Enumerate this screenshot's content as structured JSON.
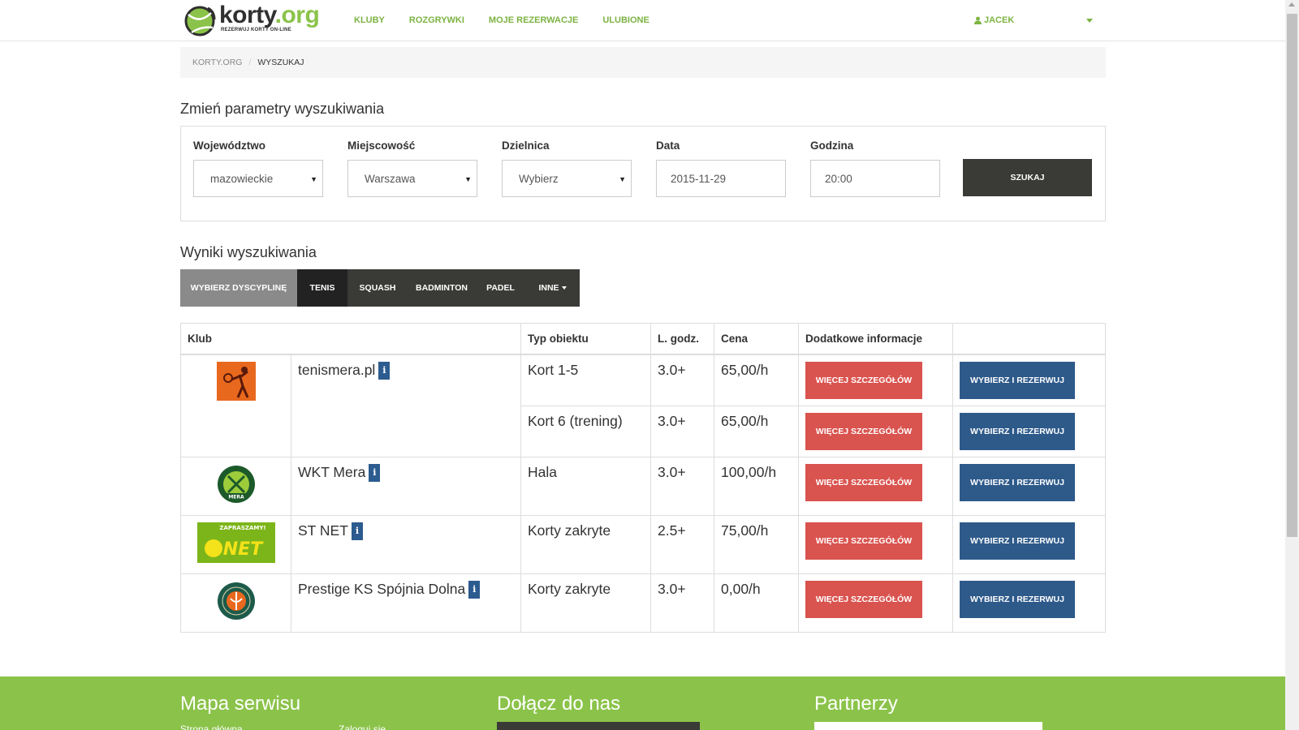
{
  "brand": {
    "name_main": "korty",
    "name_tld": ".org",
    "tagline": "REZERWUJ KORTY ON-LINE",
    "accent_color": "#8bc34a",
    "logo_icon": "tennis-ball-logo-icon"
  },
  "nav": {
    "items": [
      {
        "label": "KLUBY"
      },
      {
        "label": "ROZGRYWKI"
      },
      {
        "label": "MOJE REZERWACJE"
      },
      {
        "label": "ULUBIONE"
      }
    ],
    "user_label": "JACEK",
    "user_icon": "user-icon"
  },
  "breadcrumb": {
    "home": "KORTY.ORG",
    "separator": "/",
    "current": "WYSZUKAJ"
  },
  "search": {
    "title": "Zmień parametry wyszukiwania",
    "voivodeship": {
      "label": "Województwo",
      "value": "mazowieckie"
    },
    "city": {
      "label": "Miejscowość",
      "value": "Warszawa"
    },
    "district": {
      "label": "Dzielnica",
      "value": "Wybierz"
    },
    "date": {
      "label": "Data",
      "value": "2015-11-29"
    },
    "time": {
      "label": "Godzina",
      "value": "20:00"
    },
    "submit_label": "SZUKAJ"
  },
  "results": {
    "title": "Wyniki wyszukiwania",
    "discipline_label": "WYBIERZ DYSCYPLINĘ",
    "disciplines": [
      "TENIS",
      "SQUASH",
      "BADMINTON",
      "PADEL",
      "INNE"
    ],
    "active_discipline": "TENIS",
    "columns": [
      "Klub",
      "Typ obiektu",
      "L. godz.",
      "Cena",
      "Dodatkowe informacje",
      ""
    ],
    "info_glyph": "i",
    "more_label": "WIĘCEJ SZCZEGÓŁÓW",
    "book_label": "WYBIERZ I REZERWUJ",
    "clubs": [
      {
        "name": "tenismera.pl",
        "logo_icon": "tenismera-logo-icon",
        "rows": [
          {
            "type": "Kort 1-5",
            "hours": "3.0+",
            "price": "65,00/h"
          },
          {
            "type": "Kort 6 (trening)",
            "hours": "3.0+",
            "price": "65,00/h"
          }
        ]
      },
      {
        "name": "WKT Mera",
        "logo_icon": "wkt-mera-logo-icon",
        "rows": [
          {
            "type": "Hala",
            "hours": "3.0+",
            "price": "100,00/h"
          }
        ]
      },
      {
        "name": "ST NET",
        "logo_icon": "st-net-logo-icon",
        "logo_text": "ZAPRASZAMY!",
        "rows": [
          {
            "type": "Korty zakryte",
            "hours": "2.5+",
            "price": "75,00/h"
          }
        ]
      },
      {
        "name": "Prestige KS Spójnia Dolna",
        "logo_icon": "prestige-logo-icon",
        "rows": [
          {
            "type": "Korty zakryte",
            "hours": "3.0+",
            "price": "0,00/h"
          }
        ]
      }
    ]
  },
  "footer": {
    "sitemap_title": "Mapa serwisu",
    "join_title": "Dołącz do nas",
    "partners_title": "Partnerzy",
    "links": [
      "Strona główna",
      "Zaloguj się"
    ]
  },
  "colors": {
    "green": "#8bc34a",
    "dark": "#3a3a37",
    "red": "#d9534f",
    "blue": "#2e5a8a"
  }
}
